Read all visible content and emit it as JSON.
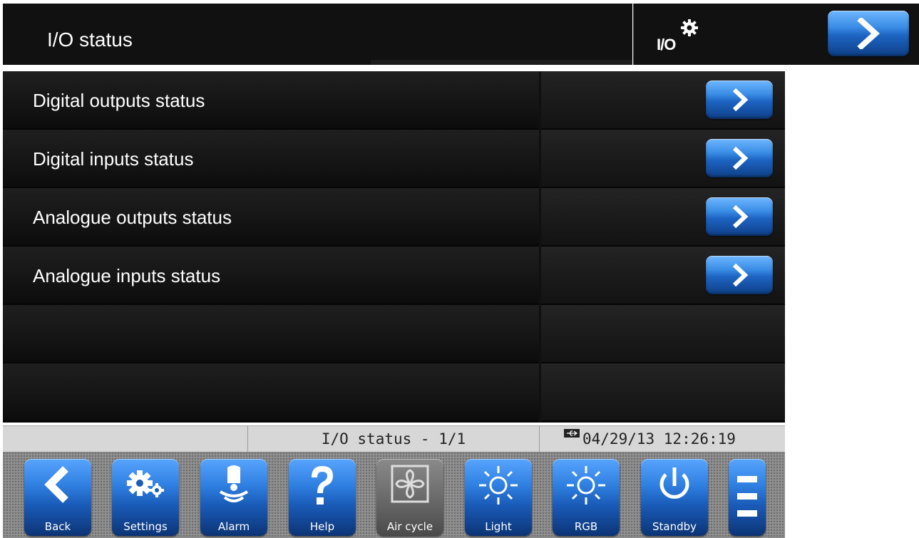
{
  "header": {
    "title": "I/O status",
    "io_label": "I/O",
    "io_icon": "gear-icon",
    "next_icon": "chevron-right-icon"
  },
  "list": {
    "rows": [
      {
        "label": "Digital outputs status",
        "has_arrow": true
      },
      {
        "label": "Digital inputs status",
        "has_arrow": true
      },
      {
        "label": "Analogue outputs status",
        "has_arrow": true
      },
      {
        "label": "Analogue inputs status",
        "has_arrow": true
      },
      {
        "label": "",
        "has_arrow": false
      },
      {
        "label": "",
        "has_arrow": false
      }
    ]
  },
  "status_bar": {
    "page": "I/O status - 1/1",
    "datetime": "04/29/13 12:26:19",
    "usb_icon": "usb-icon"
  },
  "toolbar": {
    "buttons": [
      {
        "label": "Back",
        "icon": "back-chevron-icon",
        "enabled": true
      },
      {
        "label": "Settings",
        "icon": "gears-icon",
        "enabled": true
      },
      {
        "label": "Alarm",
        "icon": "bell-icon",
        "enabled": true
      },
      {
        "label": "Help",
        "icon": "question-icon",
        "enabled": true
      },
      {
        "label": "Air cycle",
        "icon": "fan-icon",
        "enabled": false
      },
      {
        "label": "Light",
        "icon": "sun-icon",
        "enabled": true
      },
      {
        "label": "RGB",
        "icon": "sun-icon",
        "enabled": true
      },
      {
        "label": "Standby",
        "icon": "power-icon",
        "enabled": true
      }
    ],
    "menu_icon": "menu-icon"
  },
  "colors": {
    "accent_blue": "#2e7fe0",
    "panel_dark": "#111111",
    "status_bg": "#d7d7d7"
  }
}
